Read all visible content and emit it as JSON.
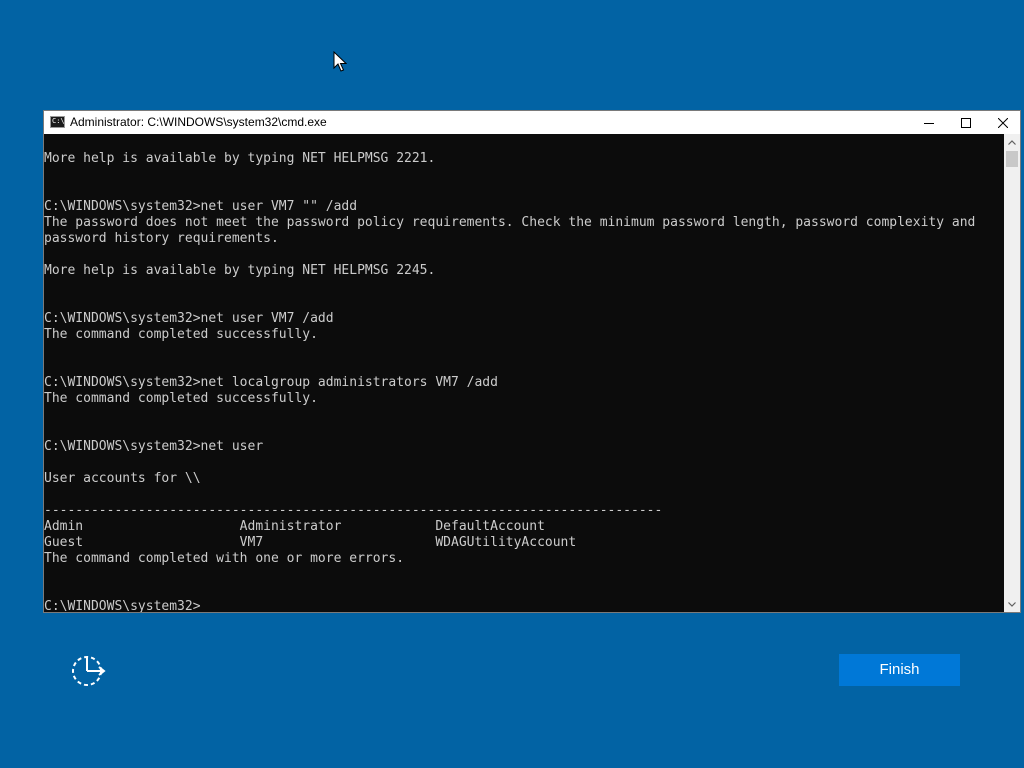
{
  "window": {
    "title": "Administrator: C:\\WINDOWS\\system32\\cmd.exe",
    "icon_text": "C:\\",
    "controls": {
      "minimize_icon": "minimize-icon",
      "maximize_icon": "maximize-icon",
      "close_icon": "close-icon"
    }
  },
  "console": {
    "lines": [
      "More help is available by typing NET HELPMSG 2221.",
      "",
      "",
      "C:\\WINDOWS\\system32>net user VM7 \"\" /add",
      "The password does not meet the password policy requirements. Check the minimum password length, password complexity and",
      "password history requirements.",
      "",
      "More help is available by typing NET HELPMSG 2245.",
      "",
      "",
      "C:\\WINDOWS\\system32>net user VM7 /add",
      "The command completed successfully.",
      "",
      "",
      "C:\\WINDOWS\\system32>net localgroup administrators VM7 /add",
      "The command completed successfully.",
      "",
      "",
      "C:\\WINDOWS\\system32>net user",
      "",
      "User accounts for \\\\",
      "",
      "-------------------------------------------------------------------------------",
      "Admin                    Administrator            DefaultAccount",
      "Guest                    VM7                      WDAGUtilityAccount",
      "The command completed with one or more errors.",
      "",
      "",
      "C:\\WINDOWS\\system32>"
    ],
    "colors": {
      "background": "#0c0c0c",
      "text": "#cccccc"
    }
  },
  "setup": {
    "finish_label": "Finish",
    "accessibility_icon": "ease-of-access-icon",
    "background_color": "#0263a4",
    "accent_color": "#0078d7"
  }
}
